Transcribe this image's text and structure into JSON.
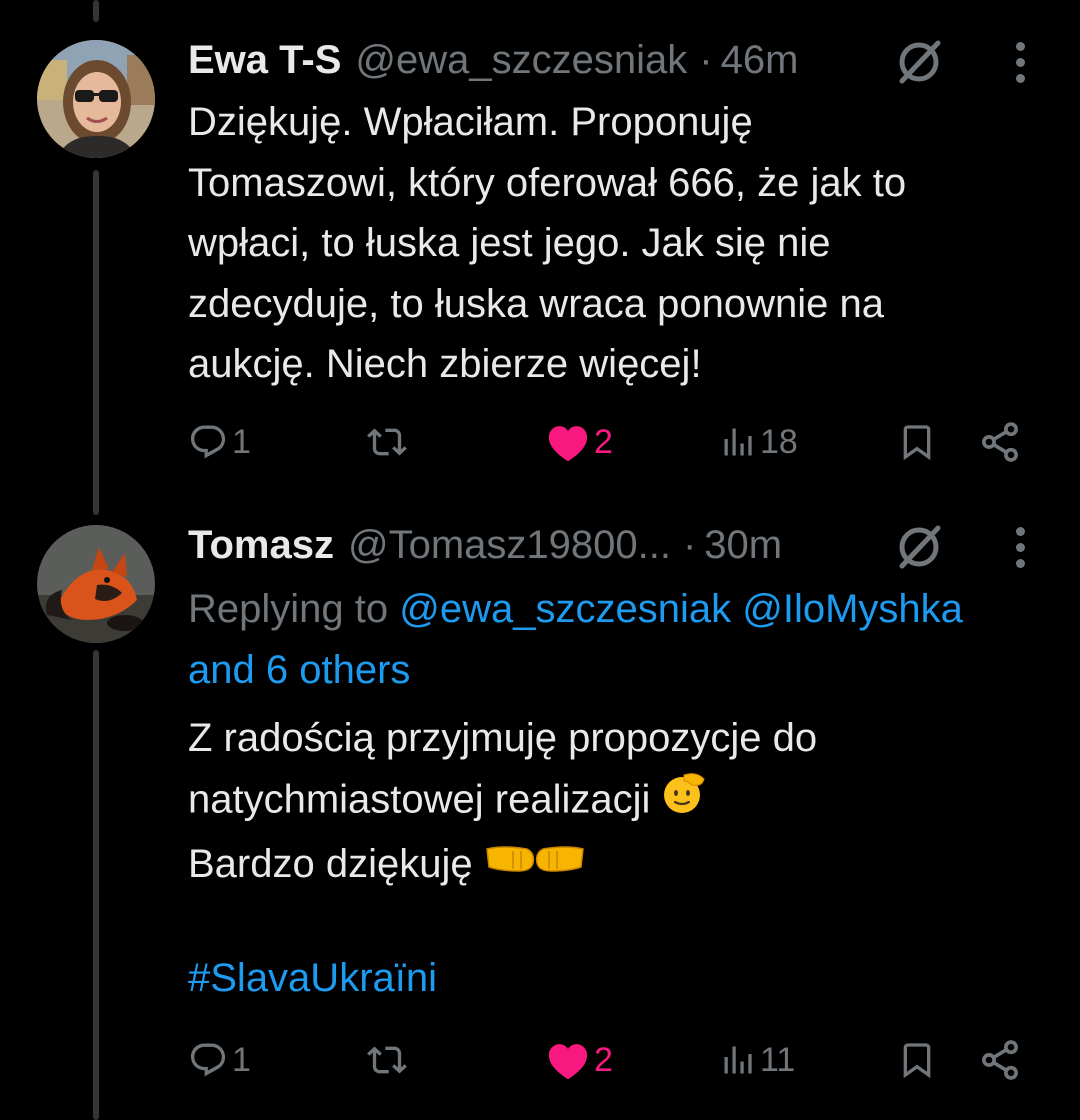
{
  "tweets": [
    {
      "name": "Ewa T-S",
      "handle": "@ewa_szczesniak",
      "separator": "·",
      "time": "46m",
      "avatar_icon": "woman-sunglasses-avatar",
      "lines": [
        "Dziękuję. Wpłaciłam. Proponuję",
        "Tomaszowi, który oferował 666, że jak to",
        "wpłaci, to łuska jest jego. Jak się nie",
        "zdecyduje, to łuska wraca ponownie na",
        "aukcję. Niech zbierze więcej!"
      ],
      "actions": {
        "replies": "1",
        "likes": "2",
        "views": "18"
      }
    },
    {
      "name": "Tomasz",
      "handle": "@Tomasz19800...",
      "separator": "·",
      "time": "30m",
      "avatar_icon": "fox-avatar",
      "replying_prefix": "Replying to ",
      "replying_mention1": "@ewa_szczesniak",
      "replying_mention2": "@IloMyshka",
      "replying_others": "and 6 others",
      "lines": [
        "Z radością przyjmuję propozycje do",
        "natychmiastowej realizacji",
        "Bardzo dziękuję"
      ],
      "emoji_line2": "saluting-face-emoji",
      "emoji_line3": "fist-bump-emoji",
      "hashtag": "#SlavaUkraïni",
      "actions": {
        "replies": "1",
        "likes": "2",
        "views": "11"
      }
    }
  ],
  "colors": {
    "background": "#000000",
    "text": "#e7e9ea",
    "secondary": "#71767b",
    "link": "#1d9bf0",
    "like": "#f91880"
  }
}
